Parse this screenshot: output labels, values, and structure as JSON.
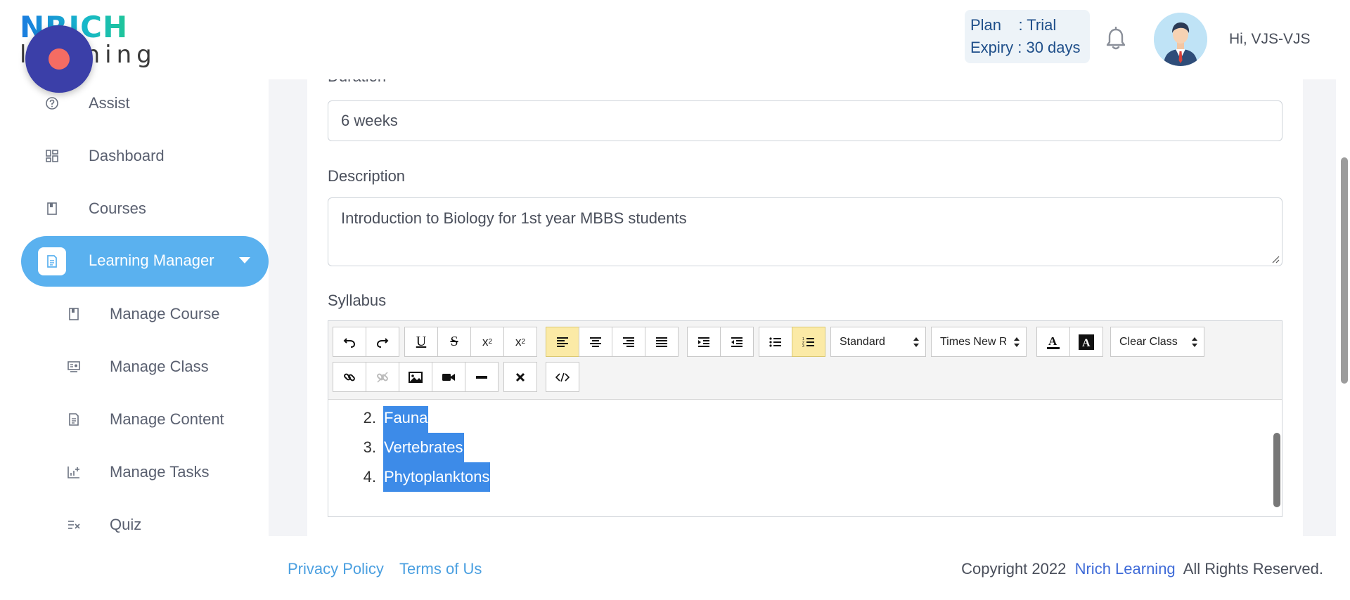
{
  "header": {
    "logo_top": "NRICH",
    "logo_bottom": "learning",
    "plan_line": "Plan    : Trial",
    "expiry_line": "Expiry : 30 days",
    "greeting": "Hi, VJS-VJS"
  },
  "sidebar": {
    "items": [
      {
        "label": "Assist",
        "icon": "help-circle-icon"
      },
      {
        "label": "Dashboard",
        "icon": "dashboard-grid-icon"
      },
      {
        "label": "Courses",
        "icon": "book-icon"
      },
      {
        "label": "Learning Manager",
        "icon": "document-icon",
        "active": true
      },
      {
        "label": "Manage Course",
        "icon": "book-icon"
      },
      {
        "label": "Manage Class",
        "icon": "presentation-icon"
      },
      {
        "label": "Manage Content",
        "icon": "document-icon"
      },
      {
        "label": "Manage Tasks",
        "icon": "chart-plus-icon"
      },
      {
        "label": "Quiz",
        "icon": "list-check-icon"
      }
    ]
  },
  "form": {
    "duration_label": "Duration",
    "duration_value": "6 weeks",
    "description_label": "Description",
    "description_value": "Introduction to Biology for 1st year MBBS students",
    "syllabus_label": "Syllabus"
  },
  "editor": {
    "paragraph_style": "Standard",
    "font_name": "Times New Roman",
    "clear_class": "Clear Class",
    "list_items": [
      {
        "num": "2.",
        "text": "Fauna"
      },
      {
        "num": "3.",
        "text": "Vertebrates"
      },
      {
        "num": "4.",
        "text": "Phytoplanktons"
      }
    ]
  },
  "footer": {
    "privacy": "Privacy Policy",
    "terms": "Terms of Us",
    "copyright_prefix": "Copyright 2022",
    "brand": "Nrich Learning",
    "copyright_suffix": "All Rights Reserved."
  },
  "colors": {
    "accent": "#5ab1ef",
    "record_button": "#3b3fa8",
    "selection": "#3d8be8",
    "active_tool": "#fbeaa6"
  }
}
